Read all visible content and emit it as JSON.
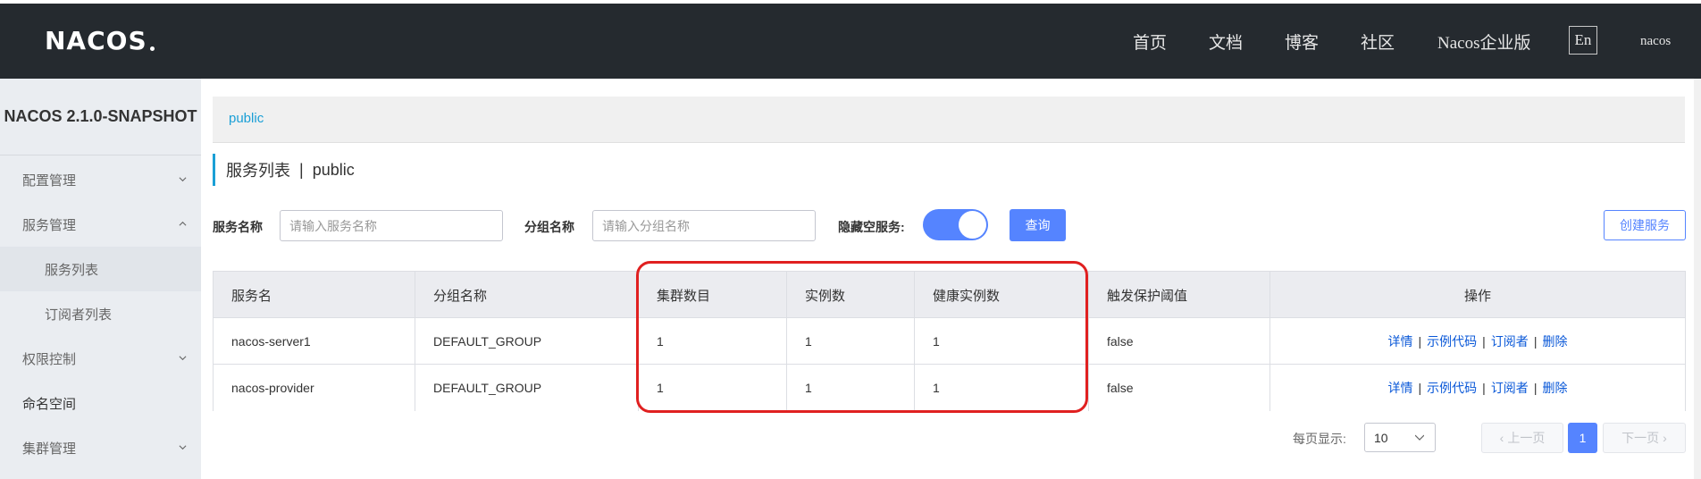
{
  "app": {
    "logo_text": "NACOS",
    "nav": [
      "首页",
      "文档",
      "博客",
      "社区",
      "Nacos企业版"
    ],
    "lang_button": "En",
    "user": "nacos"
  },
  "sidebar": {
    "title": "NACOS 2.1.0-SNAPSHOT",
    "items": [
      {
        "label": "配置管理"
      },
      {
        "label": "服务管理"
      },
      {
        "label": "服务列表"
      },
      {
        "label": "订阅者列表"
      },
      {
        "label": "权限控制"
      },
      {
        "label": "命名空间"
      },
      {
        "label": "集群管理"
      }
    ]
  },
  "breadcrumb": "public",
  "page": {
    "title": "服务列表",
    "separator": "|",
    "namespace": "public"
  },
  "filters": {
    "service_name_label": "服务名称",
    "service_name_placeholder": "请输入服务名称",
    "group_name_label": "分组名称",
    "group_name_placeholder": "请输入分组名称",
    "hide_empty_label": "隐藏空服务:",
    "hide_empty_on": true,
    "query_button": "查询",
    "create_button": "创建服务"
  },
  "table": {
    "headers": [
      "服务名",
      "分组名称",
      "集群数目",
      "实例数",
      "健康实例数",
      "触发保护阈值",
      "操作"
    ],
    "rows": [
      [
        "nacos-server1",
        "DEFAULT_GROUP",
        "1",
        "1",
        "1",
        "false"
      ],
      [
        "nacos-provider",
        "DEFAULT_GROUP",
        "1",
        "1",
        "1",
        "false"
      ]
    ],
    "actions": [
      "详情",
      "示例代码",
      "订阅者",
      "删除"
    ],
    "action_separator": "|"
  },
  "pagination": {
    "page_size_label": "每页显示:",
    "page_size": "10",
    "prev": "上一页",
    "current_page": "1",
    "next": "下一页"
  },
  "colors": {
    "header_bg": "#252a2f",
    "sidebar_bg": "#eaedf1",
    "primary": "#5584ff",
    "link": "#0a58d8",
    "breadcrumb": "#1a9fd6",
    "highlight_annotation": "#e02020"
  }
}
